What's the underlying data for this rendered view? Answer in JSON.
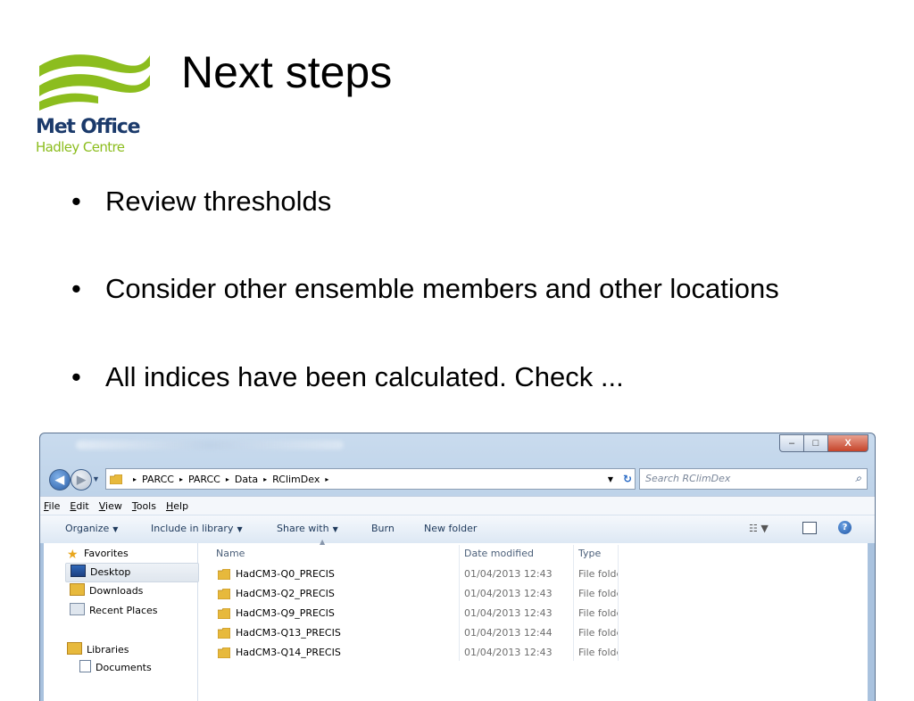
{
  "logo": {
    "name_line1": "Met Office",
    "name_line2": "Hadley Centre",
    "wave_color": "#8cbd1e",
    "text_color": "#1b3a6b"
  },
  "slide": {
    "title": "Next steps",
    "bullets": [
      {
        "marker": "•",
        "text": "Review thresholds"
      },
      {
        "marker": "•",
        "text": "Consider other ensemble members and other locations"
      },
      {
        "marker": "•",
        "text": "All indices have been calculated. Check ..."
      }
    ]
  },
  "explorer": {
    "caption_buttons": {
      "minimize": "–",
      "maximize": "□",
      "close": "X"
    },
    "address": {
      "segments": [
        "PARCC",
        "PARCC",
        "Data",
        "RClimDex"
      ],
      "separator": "▸"
    },
    "search": {
      "placeholder": "Search RClimDex"
    },
    "menus": [
      {
        "key": "F",
        "rest": "ile"
      },
      {
        "key": "E",
        "rest": "dit"
      },
      {
        "key": "V",
        "rest": "iew"
      },
      {
        "key": "T",
        "rest": "ools"
      },
      {
        "key": "H",
        "rest": "elp"
      }
    ],
    "toolbar": {
      "organize": "Organize",
      "include": "Include in library",
      "share": "Share with",
      "burn": "Burn",
      "new_folder": "New folder",
      "caret": "▼"
    },
    "nav": {
      "favorites": "Favorites",
      "desktop": "Desktop",
      "downloads": "Downloads",
      "recent": "Recent Places",
      "libraries": "Libraries",
      "documents": "Documents"
    },
    "columns": {
      "name": "Name",
      "date": "Date modified",
      "type": "Type"
    },
    "rows": [
      {
        "name": "HadCM3-Q0_PRECIS",
        "date": "01/04/2013 12:43",
        "type": "File folder"
      },
      {
        "name": "HadCM3-Q2_PRECIS",
        "date": "01/04/2013 12:43",
        "type": "File folder"
      },
      {
        "name": "HadCM3-Q9_PRECIS",
        "date": "01/04/2013 12:43",
        "type": "File folder"
      },
      {
        "name": "HadCM3-Q13_PRECIS",
        "date": "01/04/2013 12:44",
        "type": "File folder"
      },
      {
        "name": "HadCM3-Q14_PRECIS",
        "date": "01/04/2013 12:43",
        "type": "File folder"
      }
    ]
  }
}
